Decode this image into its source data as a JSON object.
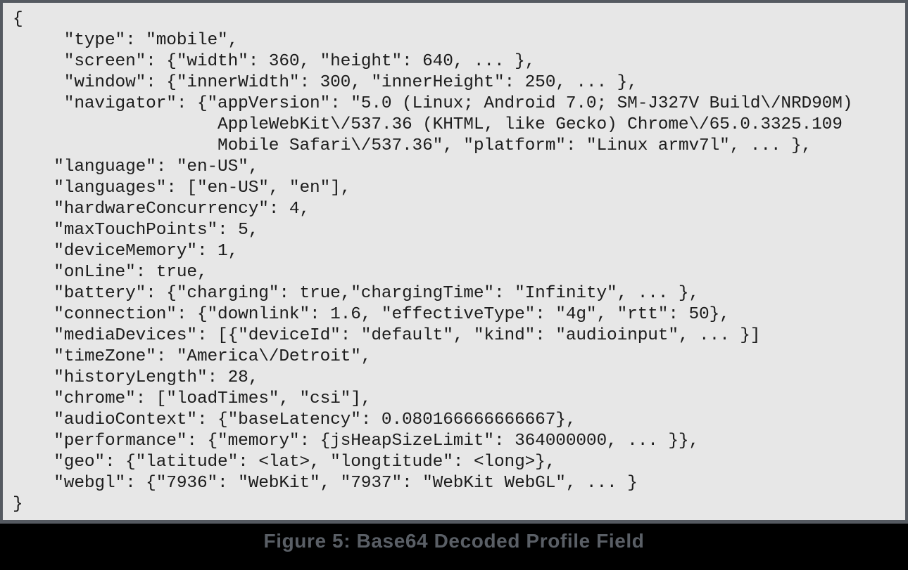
{
  "figure": {
    "caption": "Figure 5: Base64 Decoded Profile Field",
    "frame_border_color": "#555a61",
    "code_background_color": "#e7e7e7",
    "code_text_color": "#1c1c1c",
    "caption_background_color": "#000000",
    "caption_text_color": "#5a5f66"
  },
  "code": {
    "language": "json",
    "lines": [
      "{",
      "     \"type\": \"mobile\",",
      "     \"screen\": {\"width\": 360, \"height\": 640, ... },",
      "     \"window\": {\"innerWidth\": 300, \"innerHeight\": 250, ... },",
      "     \"navigator\": {\"appVersion\": \"5.0 (Linux; Android 7.0; SM-J327V Build\\/NRD90M)",
      "                    AppleWebKit\\/537.36 (KHTML, like Gecko) Chrome\\/65.0.3325.109",
      "                    Mobile Safari\\/537.36\", \"platform\": \"Linux armv7l\", ... },",
      "    \"language\": \"en-US\",",
      "    \"languages\": [\"en-US\", \"en\"],",
      "    \"hardwareConcurrency\": 4,",
      "    \"maxTouchPoints\": 5,",
      "    \"deviceMemory\": 1,",
      "    \"onLine\": true,",
      "    \"battery\": {\"charging\": true,\"chargingTime\": \"Infinity\", ... },",
      "    \"connection\": {\"downlink\": 1.6, \"effectiveType\": \"4g\", \"rtt\": 50},",
      "    \"mediaDevices\": [{\"deviceId\": \"default\", \"kind\": \"audioinput\", ... }]",
      "    \"timeZone\": \"America\\/Detroit\",",
      "    \"historyLength\": 28,",
      "    \"chrome\": [\"loadTimes\", \"csi\"],",
      "    \"audioContext\": {\"baseLatency\": 0.080166666666667},",
      "    \"performance\": {\"memory\": {jsHeapSizeLimit\": 364000000, ... }},",
      "    \"geo\": {\"latitude\": <lat>, \"longtitude\": <long>},",
      "    \"webgl\": {\"7936\": \"WebKit\", \"7937\": \"WebKit WebGL\", ... }",
      "}"
    ]
  }
}
